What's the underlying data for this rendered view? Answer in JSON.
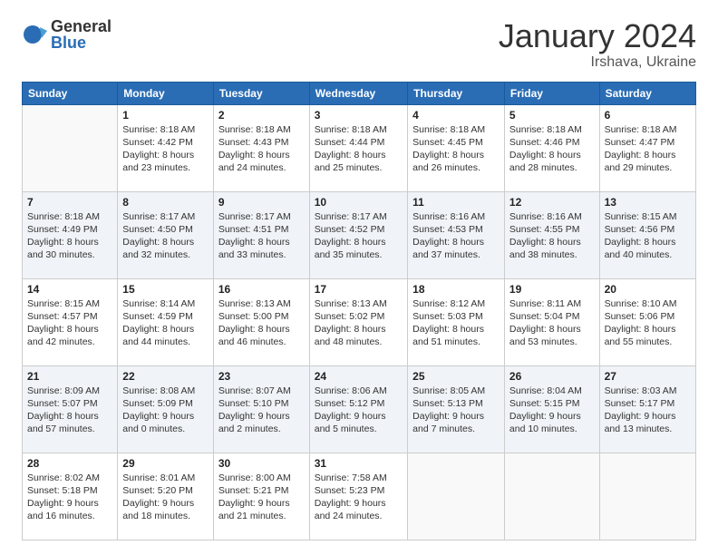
{
  "logo": {
    "general": "General",
    "blue": "Blue"
  },
  "title": "January 2024",
  "location": "Irshava, Ukraine",
  "days_of_week": [
    "Sunday",
    "Monday",
    "Tuesday",
    "Wednesday",
    "Thursday",
    "Friday",
    "Saturday"
  ],
  "weeks": [
    [
      {
        "day": "",
        "info": ""
      },
      {
        "day": "1",
        "info": "Sunrise: 8:18 AM\nSunset: 4:42 PM\nDaylight: 8 hours\nand 23 minutes."
      },
      {
        "day": "2",
        "info": "Sunrise: 8:18 AM\nSunset: 4:43 PM\nDaylight: 8 hours\nand 24 minutes."
      },
      {
        "day": "3",
        "info": "Sunrise: 8:18 AM\nSunset: 4:44 PM\nDaylight: 8 hours\nand 25 minutes."
      },
      {
        "day": "4",
        "info": "Sunrise: 8:18 AM\nSunset: 4:45 PM\nDaylight: 8 hours\nand 26 minutes."
      },
      {
        "day": "5",
        "info": "Sunrise: 8:18 AM\nSunset: 4:46 PM\nDaylight: 8 hours\nand 28 minutes."
      },
      {
        "day": "6",
        "info": "Sunrise: 8:18 AM\nSunset: 4:47 PM\nDaylight: 8 hours\nand 29 minutes."
      }
    ],
    [
      {
        "day": "7",
        "info": "Sunrise: 8:18 AM\nSunset: 4:49 PM\nDaylight: 8 hours\nand 30 minutes."
      },
      {
        "day": "8",
        "info": "Sunrise: 8:17 AM\nSunset: 4:50 PM\nDaylight: 8 hours\nand 32 minutes."
      },
      {
        "day": "9",
        "info": "Sunrise: 8:17 AM\nSunset: 4:51 PM\nDaylight: 8 hours\nand 33 minutes."
      },
      {
        "day": "10",
        "info": "Sunrise: 8:17 AM\nSunset: 4:52 PM\nDaylight: 8 hours\nand 35 minutes."
      },
      {
        "day": "11",
        "info": "Sunrise: 8:16 AM\nSunset: 4:53 PM\nDaylight: 8 hours\nand 37 minutes."
      },
      {
        "day": "12",
        "info": "Sunrise: 8:16 AM\nSunset: 4:55 PM\nDaylight: 8 hours\nand 38 minutes."
      },
      {
        "day": "13",
        "info": "Sunrise: 8:15 AM\nSunset: 4:56 PM\nDaylight: 8 hours\nand 40 minutes."
      }
    ],
    [
      {
        "day": "14",
        "info": "Sunrise: 8:15 AM\nSunset: 4:57 PM\nDaylight: 8 hours\nand 42 minutes."
      },
      {
        "day": "15",
        "info": "Sunrise: 8:14 AM\nSunset: 4:59 PM\nDaylight: 8 hours\nand 44 minutes."
      },
      {
        "day": "16",
        "info": "Sunrise: 8:13 AM\nSunset: 5:00 PM\nDaylight: 8 hours\nand 46 minutes."
      },
      {
        "day": "17",
        "info": "Sunrise: 8:13 AM\nSunset: 5:02 PM\nDaylight: 8 hours\nand 48 minutes."
      },
      {
        "day": "18",
        "info": "Sunrise: 8:12 AM\nSunset: 5:03 PM\nDaylight: 8 hours\nand 51 minutes."
      },
      {
        "day": "19",
        "info": "Sunrise: 8:11 AM\nSunset: 5:04 PM\nDaylight: 8 hours\nand 53 minutes."
      },
      {
        "day": "20",
        "info": "Sunrise: 8:10 AM\nSunset: 5:06 PM\nDaylight: 8 hours\nand 55 minutes."
      }
    ],
    [
      {
        "day": "21",
        "info": "Sunrise: 8:09 AM\nSunset: 5:07 PM\nDaylight: 8 hours\nand 57 minutes."
      },
      {
        "day": "22",
        "info": "Sunrise: 8:08 AM\nSunset: 5:09 PM\nDaylight: 9 hours\nand 0 minutes."
      },
      {
        "day": "23",
        "info": "Sunrise: 8:07 AM\nSunset: 5:10 PM\nDaylight: 9 hours\nand 2 minutes."
      },
      {
        "day": "24",
        "info": "Sunrise: 8:06 AM\nSunset: 5:12 PM\nDaylight: 9 hours\nand 5 minutes."
      },
      {
        "day": "25",
        "info": "Sunrise: 8:05 AM\nSunset: 5:13 PM\nDaylight: 9 hours\nand 7 minutes."
      },
      {
        "day": "26",
        "info": "Sunrise: 8:04 AM\nSunset: 5:15 PM\nDaylight: 9 hours\nand 10 minutes."
      },
      {
        "day": "27",
        "info": "Sunrise: 8:03 AM\nSunset: 5:17 PM\nDaylight: 9 hours\nand 13 minutes."
      }
    ],
    [
      {
        "day": "28",
        "info": "Sunrise: 8:02 AM\nSunset: 5:18 PM\nDaylight: 9 hours\nand 16 minutes."
      },
      {
        "day": "29",
        "info": "Sunrise: 8:01 AM\nSunset: 5:20 PM\nDaylight: 9 hours\nand 18 minutes."
      },
      {
        "day": "30",
        "info": "Sunrise: 8:00 AM\nSunset: 5:21 PM\nDaylight: 9 hours\nand 21 minutes."
      },
      {
        "day": "31",
        "info": "Sunrise: 7:58 AM\nSunset: 5:23 PM\nDaylight: 9 hours\nand 24 minutes."
      },
      {
        "day": "",
        "info": ""
      },
      {
        "day": "",
        "info": ""
      },
      {
        "day": "",
        "info": ""
      }
    ]
  ]
}
